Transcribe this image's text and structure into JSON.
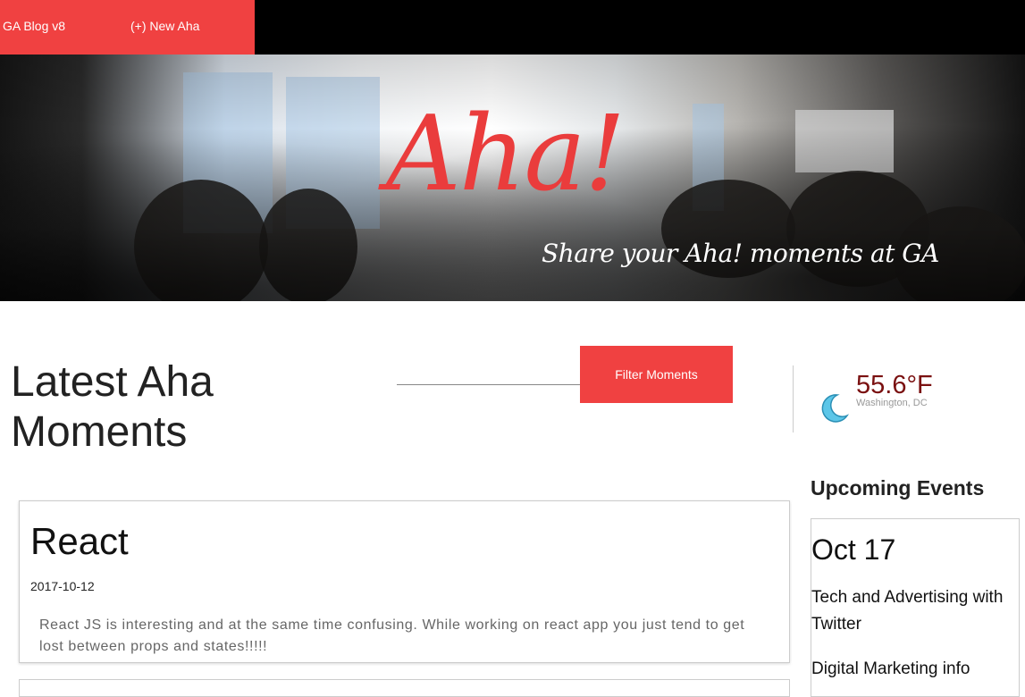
{
  "nav": {
    "brand": "GA Blog v8",
    "new_aha": "(+) New Aha"
  },
  "hero": {
    "title": "Aha!",
    "subtitle": "Share your Aha! moments at GA"
  },
  "main": {
    "title": "Latest Aha Moments",
    "filter_button": "Filter Moments"
  },
  "weather": {
    "icon": "moon-icon",
    "temperature": "55.6°F",
    "location": "Washington, DC"
  },
  "posts": [
    {
      "title": "React",
      "date": "2017-10-12",
      "body": "React JS is interesting and at the same time confusing. While working on react app you just tend to get lost between props and states!!!!!"
    }
  ],
  "sidebar": {
    "heading": "Upcoming Events",
    "event_date": "Oct 17",
    "events": [
      "Tech and Advertising with Twitter",
      "Digital Marketing info"
    ]
  },
  "colors": {
    "accent": "#f04141",
    "nav_bg": "#000000",
    "temperature": "#7a1010"
  }
}
